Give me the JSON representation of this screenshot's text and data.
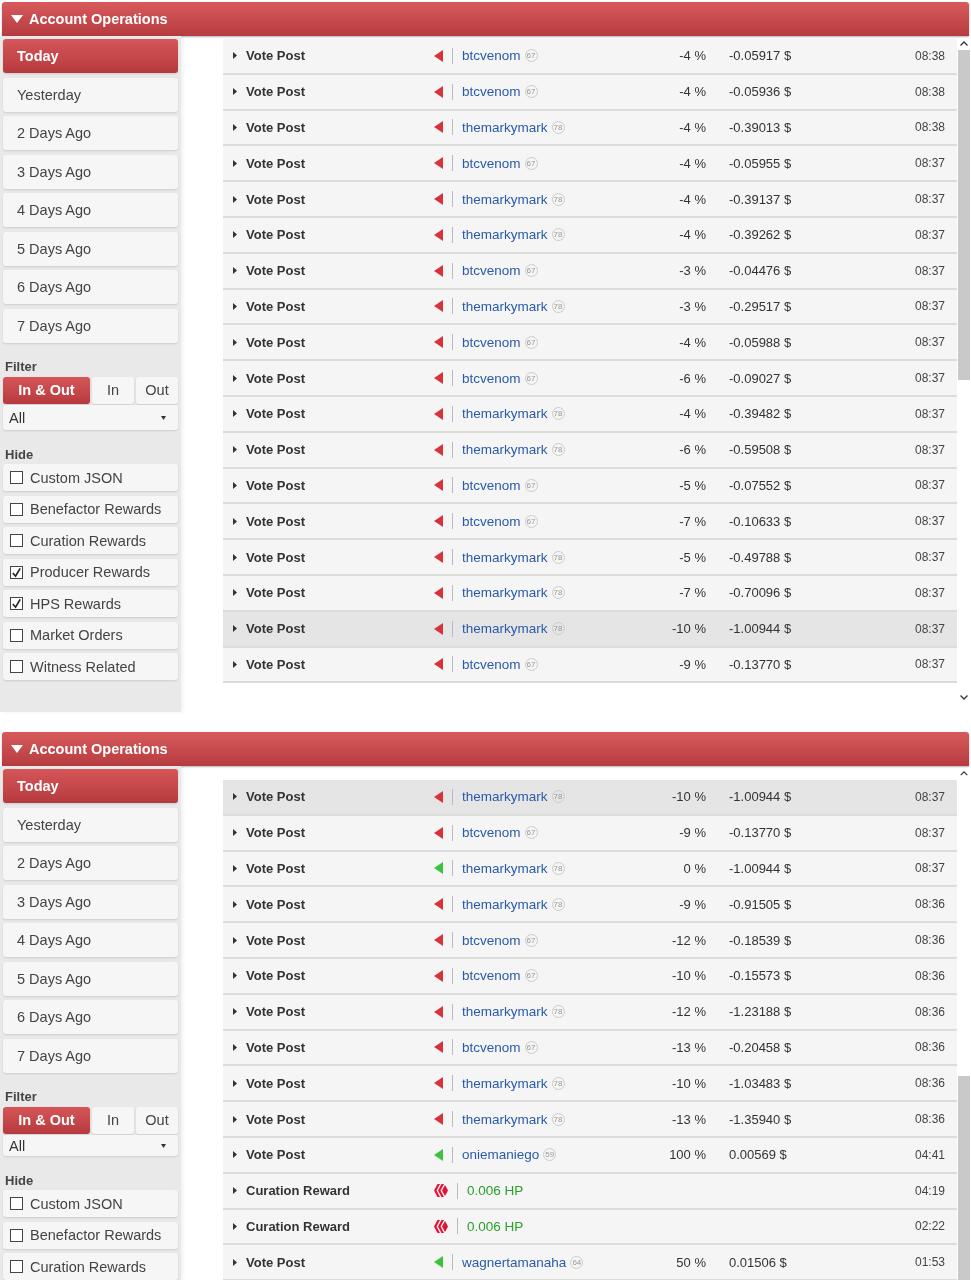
{
  "panels": [
    {
      "title": "Account Operations",
      "expanded": true,
      "date_tabs": [
        {
          "label": "Today",
          "selected": true
        },
        {
          "label": "Yesterday",
          "selected": false
        },
        {
          "label": "2 Days Ago",
          "selected": false
        },
        {
          "label": "3 Days Ago",
          "selected": false
        },
        {
          "label": "4 Days Ago",
          "selected": false
        },
        {
          "label": "5 Days Ago",
          "selected": false
        },
        {
          "label": "6 Days Ago",
          "selected": false
        },
        {
          "label": "7 Days Ago",
          "selected": false
        }
      ],
      "filter": {
        "label": "Filter",
        "options": [
          {
            "label": "In & Out",
            "selected": true
          },
          {
            "label": "In",
            "selected": false
          },
          {
            "label": "Out",
            "selected": false
          }
        ],
        "dropdown": "All"
      },
      "hide": {
        "label": "Hide",
        "items": [
          {
            "label": "Custom JSON",
            "checked": false
          },
          {
            "label": "Benefactor Rewards",
            "checked": false
          },
          {
            "label": "Curation Rewards",
            "checked": false
          },
          {
            "label": "Producer Rewards",
            "checked": true
          },
          {
            "label": "HPS Rewards",
            "checked": true
          },
          {
            "label": "Market Orders",
            "checked": false
          },
          {
            "label": "Witness Related",
            "checked": false
          }
        ]
      },
      "rows": [
        {
          "kind": "vote",
          "type": "Vote Post",
          "color": "#d8323a",
          "account": "btcvenom",
          "reputation": "67",
          "percent": "-4 %",
          "value": "-0.05917 $",
          "time": "08:38",
          "highlighted": false
        },
        {
          "kind": "vote",
          "type": "Vote Post",
          "color": "#d8323a",
          "account": "btcvenom",
          "reputation": "67",
          "percent": "-4 %",
          "value": "-0.05936 $",
          "time": "08:38",
          "highlighted": false
        },
        {
          "kind": "vote",
          "type": "Vote Post",
          "color": "#d8323a",
          "account": "themarkymark",
          "reputation": "78",
          "percent": "-4 %",
          "value": "-0.39013 $",
          "time": "08:38",
          "highlighted": false
        },
        {
          "kind": "vote",
          "type": "Vote Post",
          "color": "#d8323a",
          "account": "btcvenom",
          "reputation": "67",
          "percent": "-4 %",
          "value": "-0.05955 $",
          "time": "08:37",
          "highlighted": false
        },
        {
          "kind": "vote",
          "type": "Vote Post",
          "color": "#d8323a",
          "account": "themarkymark",
          "reputation": "78",
          "percent": "-4 %",
          "value": "-0.39137 $",
          "time": "08:37",
          "highlighted": false
        },
        {
          "kind": "vote",
          "type": "Vote Post",
          "color": "#d8323a",
          "account": "themarkymark",
          "reputation": "78",
          "percent": "-4 %",
          "value": "-0.39262 $",
          "time": "08:37",
          "highlighted": false
        },
        {
          "kind": "vote",
          "type": "Vote Post",
          "color": "#d8323a",
          "account": "btcvenom",
          "reputation": "67",
          "percent": "-3 %",
          "value": "-0.04476 $",
          "time": "08:37",
          "highlighted": false
        },
        {
          "kind": "vote",
          "type": "Vote Post",
          "color": "#d8323a",
          "account": "themarkymark",
          "reputation": "78",
          "percent": "-3 %",
          "value": "-0.29517 $",
          "time": "08:37",
          "highlighted": false
        },
        {
          "kind": "vote",
          "type": "Vote Post",
          "color": "#d8323a",
          "account": "btcvenom",
          "reputation": "67",
          "percent": "-4 %",
          "value": "-0.05988 $",
          "time": "08:37",
          "highlighted": false
        },
        {
          "kind": "vote",
          "type": "Vote Post",
          "color": "#d8323a",
          "account": "btcvenom",
          "reputation": "67",
          "percent": "-6 %",
          "value": "-0.09027 $",
          "time": "08:37",
          "highlighted": false
        },
        {
          "kind": "vote",
          "type": "Vote Post",
          "color": "#d8323a",
          "account": "themarkymark",
          "reputation": "78",
          "percent": "-4 %",
          "value": "-0.39482 $",
          "time": "08:37",
          "highlighted": false
        },
        {
          "kind": "vote",
          "type": "Vote Post",
          "color": "#d8323a",
          "account": "themarkymark",
          "reputation": "78",
          "percent": "-6 %",
          "value": "-0.59508 $",
          "time": "08:37",
          "highlighted": false
        },
        {
          "kind": "vote",
          "type": "Vote Post",
          "color": "#d8323a",
          "account": "btcvenom",
          "reputation": "67",
          "percent": "-5 %",
          "value": "-0.07552 $",
          "time": "08:37",
          "highlighted": false
        },
        {
          "kind": "vote",
          "type": "Vote Post",
          "color": "#d8323a",
          "account": "btcvenom",
          "reputation": "67",
          "percent": "-7 %",
          "value": "-0.10633 $",
          "time": "08:37",
          "highlighted": false
        },
        {
          "kind": "vote",
          "type": "Vote Post",
          "color": "#d8323a",
          "account": "themarkymark",
          "reputation": "78",
          "percent": "-5 %",
          "value": "-0.49788 $",
          "time": "08:37",
          "highlighted": false
        },
        {
          "kind": "vote",
          "type": "Vote Post",
          "color": "#d8323a",
          "account": "themarkymark",
          "reputation": "78",
          "percent": "-7 %",
          "value": "-0.70096 $",
          "time": "08:37",
          "highlighted": false
        },
        {
          "kind": "vote",
          "type": "Vote Post",
          "color": "#d8323a",
          "account": "themarkymark",
          "reputation": "78",
          "percent": "-10 %",
          "value": "-1.00944 $",
          "time": "08:37",
          "highlighted": true
        },
        {
          "kind": "vote",
          "type": "Vote Post",
          "color": "#d8323a",
          "account": "btcvenom",
          "reputation": "67",
          "percent": "-9 %",
          "value": "-0.13770 $",
          "time": "08:37",
          "highlighted": false
        }
      ]
    },
    {
      "title": "Account Operations",
      "expanded": true,
      "date_tabs": [
        {
          "label": "Today",
          "selected": true
        },
        {
          "label": "Yesterday",
          "selected": false
        },
        {
          "label": "2 Days Ago",
          "selected": false
        },
        {
          "label": "3 Days Ago",
          "selected": false
        },
        {
          "label": "4 Days Ago",
          "selected": false
        },
        {
          "label": "5 Days Ago",
          "selected": false
        },
        {
          "label": "6 Days Ago",
          "selected": false
        },
        {
          "label": "7 Days Ago",
          "selected": false
        }
      ],
      "filter": {
        "label": "Filter",
        "options": [
          {
            "label": "In & Out",
            "selected": true
          },
          {
            "label": "In",
            "selected": false
          },
          {
            "label": "Out",
            "selected": false
          }
        ],
        "dropdown": "All"
      },
      "hide": {
        "label": "Hide",
        "items": [
          {
            "label": "Custom JSON",
            "checked": false
          },
          {
            "label": "Benefactor Rewards",
            "checked": false
          },
          {
            "label": "Curation Rewards",
            "checked": false
          }
        ]
      },
      "rows": [
        {
          "kind": "vote",
          "type": "Vote Post",
          "color": "#d8323a",
          "account": "themarkymark",
          "reputation": "78",
          "percent": "-10 %",
          "value": "-1.00944 $",
          "time": "08:37",
          "highlighted": true
        },
        {
          "kind": "vote",
          "type": "Vote Post",
          "color": "#d8323a",
          "account": "btcvenom",
          "reputation": "67",
          "percent": "-9 %",
          "value": "-0.13770 $",
          "time": "08:37",
          "highlighted": false
        },
        {
          "kind": "vote",
          "type": "Vote Post",
          "color": "#3cc33c",
          "account": "themarkymark",
          "reputation": "78",
          "percent": "0 %",
          "value": "-1.00944 $",
          "time": "08:37",
          "highlighted": false
        },
        {
          "kind": "vote",
          "type": "Vote Post",
          "color": "#d8323a",
          "account": "themarkymark",
          "reputation": "78",
          "percent": "-9 %",
          "value": "-0.91505 $",
          "time": "08:36",
          "highlighted": false
        },
        {
          "kind": "vote",
          "type": "Vote Post",
          "color": "#d8323a",
          "account": "btcvenom",
          "reputation": "67",
          "percent": "-12 %",
          "value": "-0.18539 $",
          "time": "08:36",
          "highlighted": false
        },
        {
          "kind": "vote",
          "type": "Vote Post",
          "color": "#d8323a",
          "account": "btcvenom",
          "reputation": "67",
          "percent": "-10 %",
          "value": "-0.15573 $",
          "time": "08:36",
          "highlighted": false
        },
        {
          "kind": "vote",
          "type": "Vote Post",
          "color": "#d8323a",
          "account": "themarkymark",
          "reputation": "78",
          "percent": "-12 %",
          "value": "-1.23188 $",
          "time": "08:36",
          "highlighted": false
        },
        {
          "kind": "vote",
          "type": "Vote Post",
          "color": "#d8323a",
          "account": "btcvenom",
          "reputation": "67",
          "percent": "-13 %",
          "value": "-0.20458 $",
          "time": "08:36",
          "highlighted": false
        },
        {
          "kind": "vote",
          "type": "Vote Post",
          "color": "#d8323a",
          "account": "themarkymark",
          "reputation": "78",
          "percent": "-10 %",
          "value": "-1.03483 $",
          "time": "08:36",
          "highlighted": false
        },
        {
          "kind": "vote",
          "type": "Vote Post",
          "color": "#d8323a",
          "account": "themarkymark",
          "reputation": "78",
          "percent": "-13 %",
          "value": "-1.35940 $",
          "time": "08:36",
          "highlighted": false
        },
        {
          "kind": "vote",
          "type": "Vote Post",
          "color": "#3cc33c",
          "account": "oniemaniego",
          "reputation": "59",
          "percent": "100 %",
          "value": "0.00569 $",
          "time": "04:41",
          "highlighted": false
        },
        {
          "kind": "curation",
          "type": "Curation Reward",
          "reward": "0.006 HP",
          "time": "04:19",
          "highlighted": false
        },
        {
          "kind": "curation",
          "type": "Curation Reward",
          "reward": "0.006 HP",
          "time": "02:22",
          "highlighted": false
        },
        {
          "kind": "vote",
          "type": "Vote Post",
          "color": "#3cc33c",
          "account": "wagnertamanaha",
          "reputation": "64",
          "percent": "50 %",
          "value": "0.01506 $",
          "time": "01:53",
          "highlighted": false
        }
      ]
    }
  ]
}
